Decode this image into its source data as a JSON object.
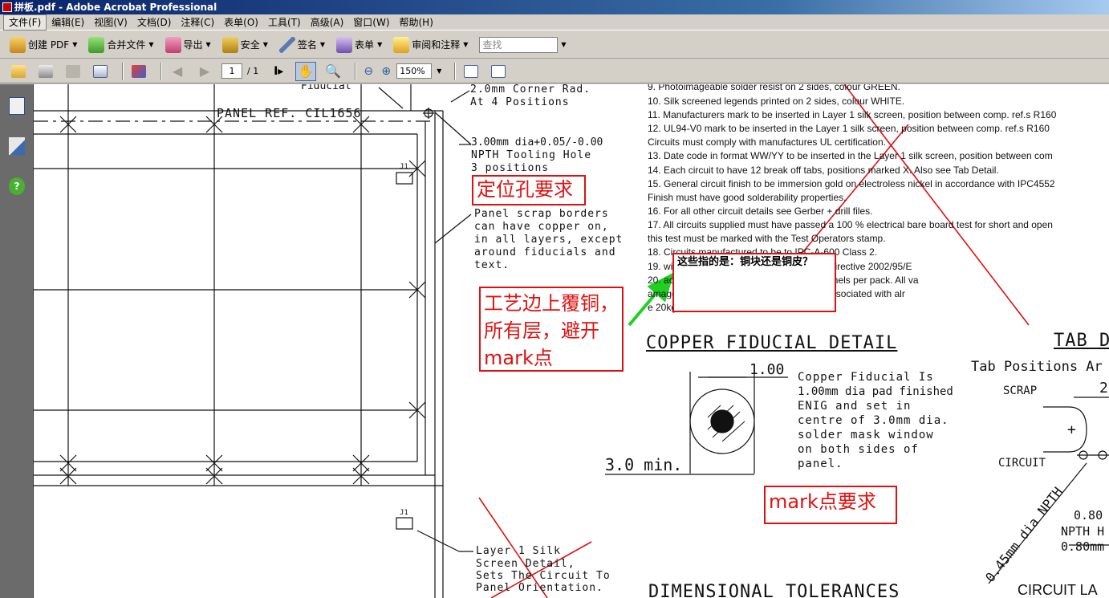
{
  "window": {
    "title": "拼板.pdf - Adobe Acrobat Professional"
  },
  "menu": [
    "文件(F)",
    "编辑(E)",
    "视图(V)",
    "文档(D)",
    "注释(C)",
    "表单(O)",
    "工具(T)",
    "高级(A)",
    "窗口(W)",
    "帮助(H)"
  ],
  "toolbar": {
    "create_pdf": "创建 PDF",
    "combine": "合并文件",
    "export": "导出",
    "security": "安全",
    "sign": "签名",
    "forms": "表单",
    "review": "审阅和注释",
    "search_placeholder": "查找"
  },
  "nav": {
    "page_current": "1",
    "page_total": "/ 1",
    "zoom": "150%"
  },
  "drawing": {
    "fiducial_label": "Fiducial",
    "panel_ref": "PANEL REF. CIL1656",
    "corner_rad": [
      "2.0mm Corner Rad.",
      "At 4 Positions"
    ],
    "tooling_hole": [
      "3.00mm dia+0.05/-0.00",
      "NPTH Tooling Hole",
      "3 positions"
    ],
    "scrap_borders": [
      "Panel scrap borders",
      "can have copper on,",
      "in all layers, except",
      "around fiducials and",
      "text."
    ],
    "silk_detail": [
      "Layer 1 Silk",
      "Screen Detail,",
      "Sets The Circuit To",
      "Panel Orientation."
    ],
    "j1_label_1": "J1",
    "j1_label_2": "J1",
    "fiducial_heading": "COPPER FIDUCIAL DETAIL",
    "fiducial_dim": "1.00",
    "fiducial_min": "3.0 min.",
    "fiducial_desc": [
      "Copper Fiducial Is",
      "1.00mm dia pad finished",
      "ENIG and set in",
      "centre of 3.0mm dia.",
      "solder mask window",
      "on both sides of",
      "panel."
    ],
    "tab_heading": "TAB D",
    "tab_sub": "Tab Positions Ar",
    "tab_scrap": "SCRAP",
    "tab_circuit": "CIRCUIT",
    "tab_two": "2",
    "tab_npth_dia": "0.45mm dia NPTH",
    "tab_080": "0.80",
    "tab_npth": "NPTH H",
    "tab_080mm": "0.80mm",
    "circuit_la": "CIRCUIT LA",
    "dim_tol": "DIMENSIONAL TOLERANCES"
  },
  "spec_lines": [
    "9.  Photoimageable solder resist on 2 sides, colour GREEN.",
    "10. Silk screened legends printed on 2 sides, colour WHITE.",
    "11. Manufacturers mark to be inserted in Layer 1 silk screen, position between comp. ref.s R160",
    "12. UL94-V0 mark to be inserted in the Layer 1 silk screen,  position between comp. ref.s R160",
    "      Circuits must comply with manufactures UL certification.",
    "13. Date code in format WW/YY  to be inserted in the Layer 1 silk screen, position between com",
    "14. Each circuit to have 12 break off tabs, positions marked X.  Also see Tab Detail.",
    "15. General circuit finish to be immersion gold on electroless nickel in accordance with IPC4552",
    "      Finish must have good solderability properties.",
    "16. For all other circuit details see Gerber + drill  files.",
    "17. All circuits supplied must have passed a 100 % electrical bare board test for short and open",
    "      this test must be marked with the Test Operators stamp.",
    "18. Circuits manufactured to be to IPC-A-600 Class 2.",
    "19.                                    with the European Parliaments ROHS Directive 2002/95/E",
    "20.                                    acuum packs, with a maximum of 20 panels per pack.  All va",
    "                                        amage to the circuits during  handling etc. associated with alr",
    "                                        e 20kg."
  ],
  "annotations": {
    "tooling": "定位孔要求",
    "copper": "工艺边上覆铜，所有层，避开mark点",
    "mark": "mark点要求",
    "note": "这些指的是：铜块还是铜皮？"
  }
}
